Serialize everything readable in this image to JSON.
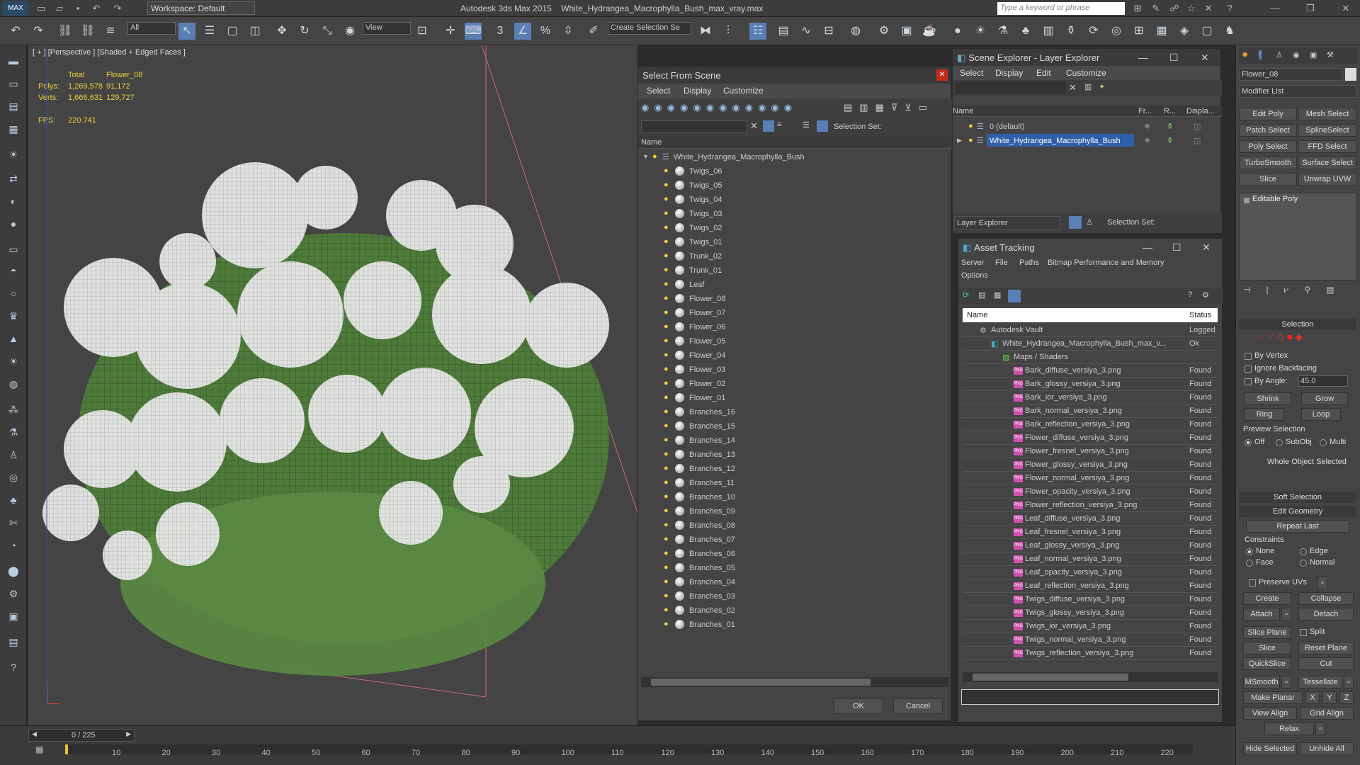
{
  "title_bar": {
    "app": "Autodesk 3ds Max  2015",
    "file": "White_Hydrangea_Macrophylla_Bush_max_vray.max",
    "workspace": "Workspace: Default",
    "search_placeholder": "Type a keyword or phrase"
  },
  "toolbar": {
    "filter": "All",
    "ref_coord": "View",
    "selection_set": "Create Selection Se"
  },
  "viewport": {
    "label": "[ + ] [Perspective ] [Shaded + Edged Faces ]",
    "stats": {
      "total_label": "Total",
      "object_label": "Flower_08",
      "polys_label": "Polys:",
      "polys_total": "1,269,578",
      "polys_obj": "91,172",
      "verts_label": "Verts:",
      "verts_total": "1,666,631",
      "verts_obj": "129,727",
      "fps_label": "FPS:",
      "fps": "220.741"
    }
  },
  "select_from_scene": {
    "title": "Select From Scene",
    "menu": [
      "Select",
      "Display",
      "Customize"
    ],
    "selection_set_label": "Selection Set:",
    "column_name": "Name",
    "root": "White_Hydrangea_Macrophylla_Bush",
    "items": [
      "Twigs_06",
      "Twigs_05",
      "Twigs_04",
      "Twigs_03",
      "Twigs_02",
      "Twigs_01",
      "Trunk_02",
      "Trunk_01",
      "Leaf",
      "Flower_08",
      "Flower_07",
      "Flower_06",
      "Flower_05",
      "Flower_04",
      "Flower_03",
      "Flower_02",
      "Flower_01",
      "Branches_16",
      "Branches_15",
      "Branches_14",
      "Branches_13",
      "Branches_12",
      "Branches_11",
      "Branches_10",
      "Branches_09",
      "Branches_08",
      "Branches_07",
      "Branches_06",
      "Branches_05",
      "Branches_04",
      "Branches_03",
      "Branches_02",
      "Branches_01"
    ],
    "ok": "OK",
    "cancel": "Cancel"
  },
  "scene_explorer": {
    "title": "Scene Explorer - Layer Explorer",
    "menu": [
      "Select",
      "Display",
      "Edit",
      "Customize"
    ],
    "columns": [
      "Name",
      "Fr...",
      "R...",
      "Displa..."
    ],
    "layers": [
      "0 (default)",
      "White_Hydrangea_Macrophylla_Bush"
    ],
    "footer_dropdown": "Layer Explorer",
    "selection_set_label": "Selection Set:"
  },
  "asset_tracking": {
    "title": "Asset Tracking",
    "menu": [
      "Server",
      "File",
      "Paths",
      "Bitmap Performance and Memory",
      "Options"
    ],
    "col_name": "Name",
    "col_status": "Status",
    "vault": {
      "name": "Autodesk Vault",
      "status": "Logged"
    },
    "file": {
      "name": "White_Hydrangea_Macrophylla_Bush_max_v...",
      "status": "Ok"
    },
    "group": "Maps / Shaders",
    "maps": [
      "Bark_diffuse_versiya_3.png",
      "Bark_glossy_versiya_3.png",
      "Bark_ior_versiya_3.png",
      "Bark_normal_versiya_3.png",
      "Bark_reflection_versiya_3.png",
      "Flower_diffuse_versiya_3.png",
      "Flower_fresnel_versiya_3.png",
      "Flower_glossy_versiya_3.png",
      "Flower_normal_versiya_3.png",
      "Flower_opacity_versiya_3.png",
      "Flower_reflection_versiya_3.png",
      "Leaf_diffuse_versiya_3.png",
      "Leaf_fresnel_versiya_3.png",
      "Leaf_glossy_versiya_3.png",
      "Leaf_normal_versiya_3.png",
      "Leaf_opacity_versiya_3.png",
      "Leaf_reflection_versiya_3.png",
      "Twigs_diffuse_versiya_3.png",
      "Twigs_glossy_versiya_3.png",
      "Twigs_ior_versiya_3.png",
      "Twigs_normal_versiya_3.png",
      "Twigs_reflection_versiya_3.png"
    ],
    "map_status": "Found"
  },
  "command_panel": {
    "object_name": "Flower_08",
    "modifier_list": "Modifier List",
    "buttons": [
      "Edit Poly",
      "Mesh Select",
      "Patch Select",
      "SplineSelect",
      "Poly Select",
      "FFD Select",
      "TurboSmooth",
      "Surface Select",
      "Slice",
      "Unwrap UVW"
    ],
    "stack_item": "Editable Poly",
    "selection": {
      "header": "Selection",
      "by_vertex": "By Vertex",
      "ignore_backfacing": "Ignore Backfacing",
      "by_angle": "By Angle:",
      "angle_value": "45.0",
      "shrink": "Shrink",
      "grow": "Grow",
      "ring": "Ring",
      "loop": "Loop",
      "preview_label": "Preview Selection",
      "preview_options": [
        "Off",
        "SubObj",
        "Multi"
      ],
      "whole_object": "Whole Object Selected"
    },
    "soft_selection": "Soft Selection",
    "edit_geometry": {
      "header": "Edit Geometry",
      "repeat_last": "Repeat Last",
      "constraints": "Constraints",
      "c_none": "None",
      "c_edge": "Edge",
      "c_face": "Face",
      "c_normal": "Normal",
      "preserve_uvs": "Preserve UVs",
      "create": "Create",
      "collapse": "Collapse",
      "attach": "Attach",
      "detach": "Detach",
      "slice_plane": "Slice Plane",
      "split": "Split",
      "slice": "Slice",
      "reset_plane": "Reset Plane",
      "quickslice": "QuickSlice",
      "cut": "Cut",
      "msmooth": "MSmooth",
      "tessellate": "Tessellate",
      "make_planar": "Make Planar",
      "x": "X",
      "y": "Y",
      "z": "Z",
      "view_align": "View Align",
      "grid_align": "Grid Align",
      "relax": "Relax",
      "hide_selected": "Hide Selected",
      "unhide_all": "Unhide All"
    }
  },
  "timeline": {
    "frame": "0 / 225",
    "ticks": [
      "10",
      "20",
      "30",
      "40",
      "50",
      "60",
      "70",
      "80",
      "90",
      "100",
      "110",
      "120",
      "130",
      "140",
      "150",
      "160",
      "170",
      "180",
      "190",
      "200",
      "210",
      "220"
    ]
  },
  "colors": {
    "accent_selected": "#2f5fa8",
    "stats_yellow": "#e7d43a",
    "png_icon": "#d050b0"
  }
}
